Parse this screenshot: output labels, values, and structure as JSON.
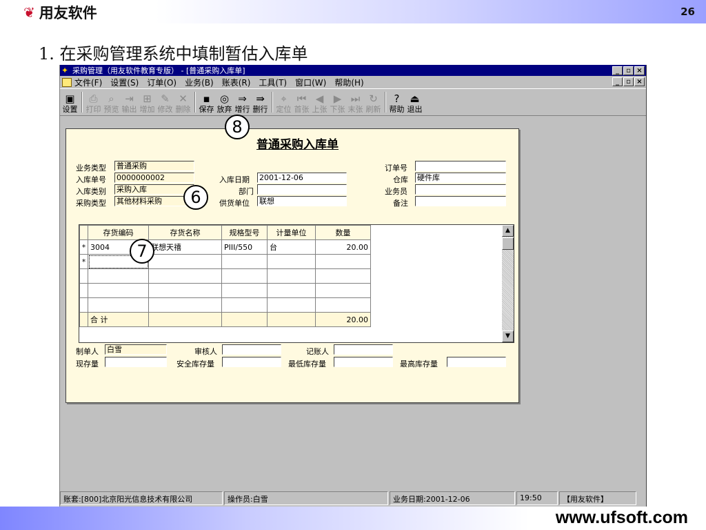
{
  "slide": {
    "logo_text": "用友软件",
    "page_number": "26",
    "title": "1. 在采购管理系统中填制暂估入库单",
    "site": "www.ufsoft.com"
  },
  "window": {
    "title": "采购管理（用友软件教育专版） - [普通采购入库单]",
    "menus": [
      "文件(F)",
      "设置(S)",
      "订单(O)",
      "业务(B)",
      "账表(R)",
      "工具(T)",
      "窗口(W)",
      "帮助(H)"
    ],
    "window_buttons": [
      "_",
      "ꟾ",
      "×"
    ]
  },
  "toolbar": [
    {
      "label": "设置",
      "icon": "settings-icon",
      "glyph": "▣",
      "enabled": true
    },
    {
      "label": "打印",
      "icon": "print-icon",
      "glyph": "⎙",
      "enabled": false
    },
    {
      "label": "预览",
      "icon": "preview-icon",
      "glyph": "⌕",
      "enabled": false
    },
    {
      "label": "输出",
      "icon": "export-icon",
      "glyph": "⇥",
      "enabled": false
    },
    {
      "label": "增加",
      "icon": "add-icon",
      "glyph": "⊞",
      "enabled": false
    },
    {
      "label": "修改",
      "icon": "edit-icon",
      "glyph": "✎",
      "enabled": false
    },
    {
      "label": "删除",
      "icon": "delete-icon",
      "glyph": "✕",
      "enabled": false
    },
    {
      "label": "保存",
      "icon": "save-icon",
      "glyph": "▪",
      "enabled": true
    },
    {
      "label": "放弃",
      "icon": "discard-icon",
      "glyph": "◎",
      "enabled": true
    },
    {
      "label": "增行",
      "icon": "add-row-icon",
      "glyph": "⇒",
      "enabled": true
    },
    {
      "label": "删行",
      "icon": "delete-row-icon",
      "glyph": "⇛",
      "enabled": true
    },
    {
      "label": "定位",
      "icon": "locate-icon",
      "glyph": "⌖",
      "enabled": false
    },
    {
      "label": "首张",
      "icon": "first-icon",
      "glyph": "⏮",
      "enabled": false
    },
    {
      "label": "上张",
      "icon": "prev-icon",
      "glyph": "◀",
      "enabled": false
    },
    {
      "label": "下张",
      "icon": "next-icon",
      "glyph": "▶",
      "enabled": false
    },
    {
      "label": "末张",
      "icon": "last-icon",
      "glyph": "⏭",
      "enabled": false
    },
    {
      "label": "刷新",
      "icon": "refresh-icon",
      "glyph": "↻",
      "enabled": false
    },
    {
      "label": "帮助",
      "icon": "help-icon",
      "glyph": "?",
      "enabled": true
    },
    {
      "label": "退出",
      "icon": "exit-icon",
      "glyph": "⏏",
      "enabled": true
    }
  ],
  "form": {
    "title": "普通采购入库单",
    "biz_type_label": "业务类型",
    "biz_type": "普通采购",
    "receipt_no_label": "入库单号",
    "receipt_no": "0000000002",
    "receipt_cat_label": "入库类别",
    "receipt_cat": "采购入库",
    "purchase_type_label": "采购类型",
    "purchase_type": "其他材料采购",
    "date_label": "入库日期",
    "date": "2001-12-06",
    "dept_label": "部门",
    "dept": "",
    "supplier_label": "供货单位",
    "supplier": "联想",
    "order_no_label": "订单号",
    "order_no": "",
    "warehouse_label": "仓库",
    "warehouse": "硬件库",
    "clerk_label": "业务员",
    "clerk": "",
    "note_label": "备注",
    "note": "",
    "maker_label": "制单人",
    "maker": "白雪",
    "reviewer_label": "审核人",
    "reviewer": "",
    "bookkeeper_label": "记账人",
    "bookkeeper": "",
    "stock_label": "现存量",
    "stock": "",
    "safety_label": "安全库存量",
    "safety": "",
    "min_label": "最低库存量",
    "min": "",
    "max_label": "最高库存量",
    "max": ""
  },
  "grid": {
    "headers": [
      "存货编码",
      "存货名称",
      "规格型号",
      "计量单位",
      "数量"
    ],
    "rows": [
      {
        "marker": "*",
        "code": "3004",
        "name": "联想天禧",
        "spec": "PIII/550",
        "unit": "台",
        "qty": "20.00"
      },
      {
        "marker": "*",
        "code": "",
        "name": "",
        "spec": "",
        "unit": "",
        "qty": ""
      }
    ],
    "total_label": "合  计",
    "total_qty": "20.00"
  },
  "statusbar": {
    "account": "账套:[800]北京阳光信息技术有限公司",
    "operator": "操作员:白雪",
    "empty": "",
    "biz_date": "业务日期:2001-12-06",
    "time": "19:50",
    "brand": "【用友软件】"
  },
  "callouts": [
    "8",
    "6",
    "7"
  ]
}
